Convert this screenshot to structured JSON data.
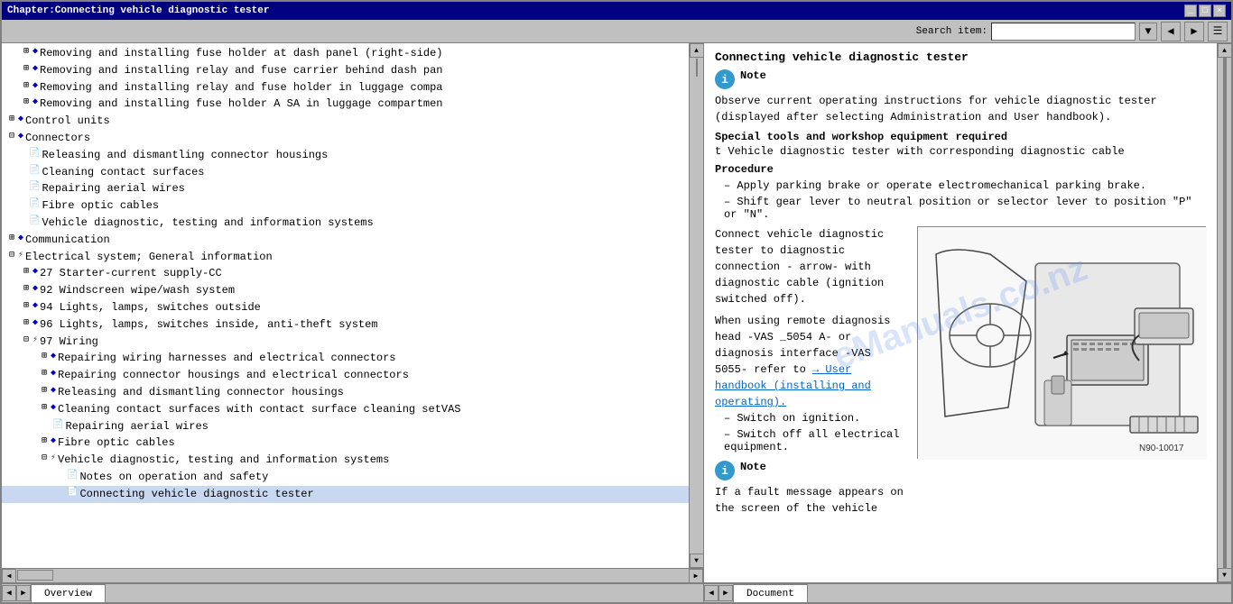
{
  "titleBar": {
    "text": "Chapter:Connecting vehicle diagnostic tester"
  },
  "toolbar": {
    "searchLabel": "Search item:",
    "searchPlaceholder": ""
  },
  "leftPanel": {
    "items": [
      {
        "level": 1,
        "type": "expand",
        "icon": "blue-diamond",
        "text": "Removing and installing fuse holder at dash panel (right-side)",
        "expanded": false
      },
      {
        "level": 1,
        "type": "expand",
        "icon": "blue-diamond",
        "text": "Removing and installing relay and fuse carrier behind dash pan",
        "expanded": false
      },
      {
        "level": 1,
        "type": "expand",
        "icon": "blue-diamond",
        "text": "Removing and installing relay and fuse holder in luggage compa",
        "expanded": false
      },
      {
        "level": 1,
        "type": "expand",
        "icon": "blue-diamond",
        "text": "Removing and installing fuse holder A SA in luggage compartmen",
        "expanded": false
      },
      {
        "level": 0,
        "type": "expand",
        "icon": "blue-diamond",
        "text": "Control units",
        "expanded": false
      },
      {
        "level": 0,
        "type": "expand-open",
        "icon": "blue-diamond",
        "text": "Connectors",
        "expanded": true
      },
      {
        "level": 1,
        "type": "doc",
        "icon": "doc",
        "text": "Releasing and dismantling connector housings"
      },
      {
        "level": 1,
        "type": "doc",
        "icon": "doc",
        "text": "Cleaning contact surfaces"
      },
      {
        "level": 1,
        "type": "doc",
        "icon": "doc",
        "text": "Repairing aerial wires"
      },
      {
        "level": 1,
        "type": "doc",
        "icon": "doc",
        "text": "Fibre optic cables"
      },
      {
        "level": 1,
        "type": "doc",
        "icon": "doc",
        "text": "Vehicle diagnostic, testing and information systems"
      },
      {
        "level": 0,
        "type": "expand",
        "icon": "blue-diamond",
        "text": "Communication",
        "expanded": false
      },
      {
        "level": 0,
        "type": "doc",
        "icon": "electrical",
        "text": "Electrical system; General information"
      },
      {
        "level": 0,
        "type": "expand-open",
        "icon": "electrical",
        "text": "",
        "expanded": true
      },
      {
        "level": 1,
        "type": "expand",
        "icon": "blue-diamond",
        "text": "27 Starter-current supply-CC",
        "expanded": false
      },
      {
        "level": 1,
        "type": "expand",
        "icon": "blue-diamond",
        "text": "92 Windscreen wipe/wash system",
        "expanded": false
      },
      {
        "level": 1,
        "type": "expand",
        "icon": "blue-diamond",
        "text": "94 Lights, lamps, switches outside",
        "expanded": false
      },
      {
        "level": 1,
        "type": "expand",
        "icon": "blue-diamond",
        "text": "96 Lights, lamps, switches inside, anti-theft system",
        "expanded": false
      },
      {
        "level": 1,
        "type": "expand-open",
        "icon": "electrical",
        "text": "97 Wiring",
        "expanded": true
      },
      {
        "level": 2,
        "type": "expand",
        "icon": "blue-diamond",
        "text": "Repairing wiring harnesses and electrical connectors",
        "expanded": false
      },
      {
        "level": 2,
        "type": "expand",
        "icon": "blue-diamond",
        "text": "Repairing connector housings and electrical connectors",
        "expanded": false
      },
      {
        "level": 2,
        "type": "expand",
        "icon": "blue-diamond",
        "text": "Releasing and dismantling connector housings",
        "expanded": false
      },
      {
        "level": 2,
        "type": "expand",
        "icon": "blue-diamond",
        "text": "Cleaning contact surfaces with contact surface cleaning setVAS ",
        "expanded": false
      },
      {
        "level": 2,
        "type": "doc",
        "icon": "doc",
        "text": "Repairing aerial wires"
      },
      {
        "level": 2,
        "type": "expand",
        "icon": "blue-diamond",
        "text": "Fibre optic cables",
        "expanded": false
      },
      {
        "level": 2,
        "type": "expand-open",
        "icon": "electrical",
        "text": "Vehicle diagnostic, testing and information systems",
        "expanded": true
      },
      {
        "level": 3,
        "type": "doc",
        "icon": "doc",
        "text": "Notes on operation and safety"
      },
      {
        "level": 3,
        "type": "doc",
        "icon": "doc",
        "text": "Connecting vehicle diagnostic tester",
        "active": true
      }
    ]
  },
  "rightPanel": {
    "title": "Connecting vehicle diagnostic tester",
    "noteLabel": "Note",
    "noteText": "Observe current operating instructions for vehicle diagnostic tester (displayed after selecting Administration and User handbook).",
    "specialToolsLabel": "Special tools and workshop equipment required",
    "toolItem": "t  Vehicle diagnostic tester with corresponding diagnostic cable",
    "procedureLabel": "Procedure",
    "steps": [
      "Apply parking brake or operate electromechanical parking brake.",
      "Shift gear lever to neutral position or selector lever to position \"P\" or \"N\"."
    ],
    "connectText": "Connect vehicle diagnostic tester to diagnostic connection - arrow- with diagnostic cable (ignition switched off).",
    "remoteText": "When using remote diagnosis head -VAS _5054 A- or diagnosis interface -VAS 5055- refer to",
    "linkText": "→ User handbook (installing and operating).",
    "switchOnText": "Switch on ignition.",
    "switchOffText": "Switch off all electrical equipment.",
    "note2Label": "Note",
    "note2Text": "If a fault message appears on the screen of the vehicle",
    "diagramLabel": "N90-10017",
    "arrowText": "arrow - With diagnostic"
  },
  "bottomTabs": {
    "left": "Overview",
    "right": "Document"
  }
}
